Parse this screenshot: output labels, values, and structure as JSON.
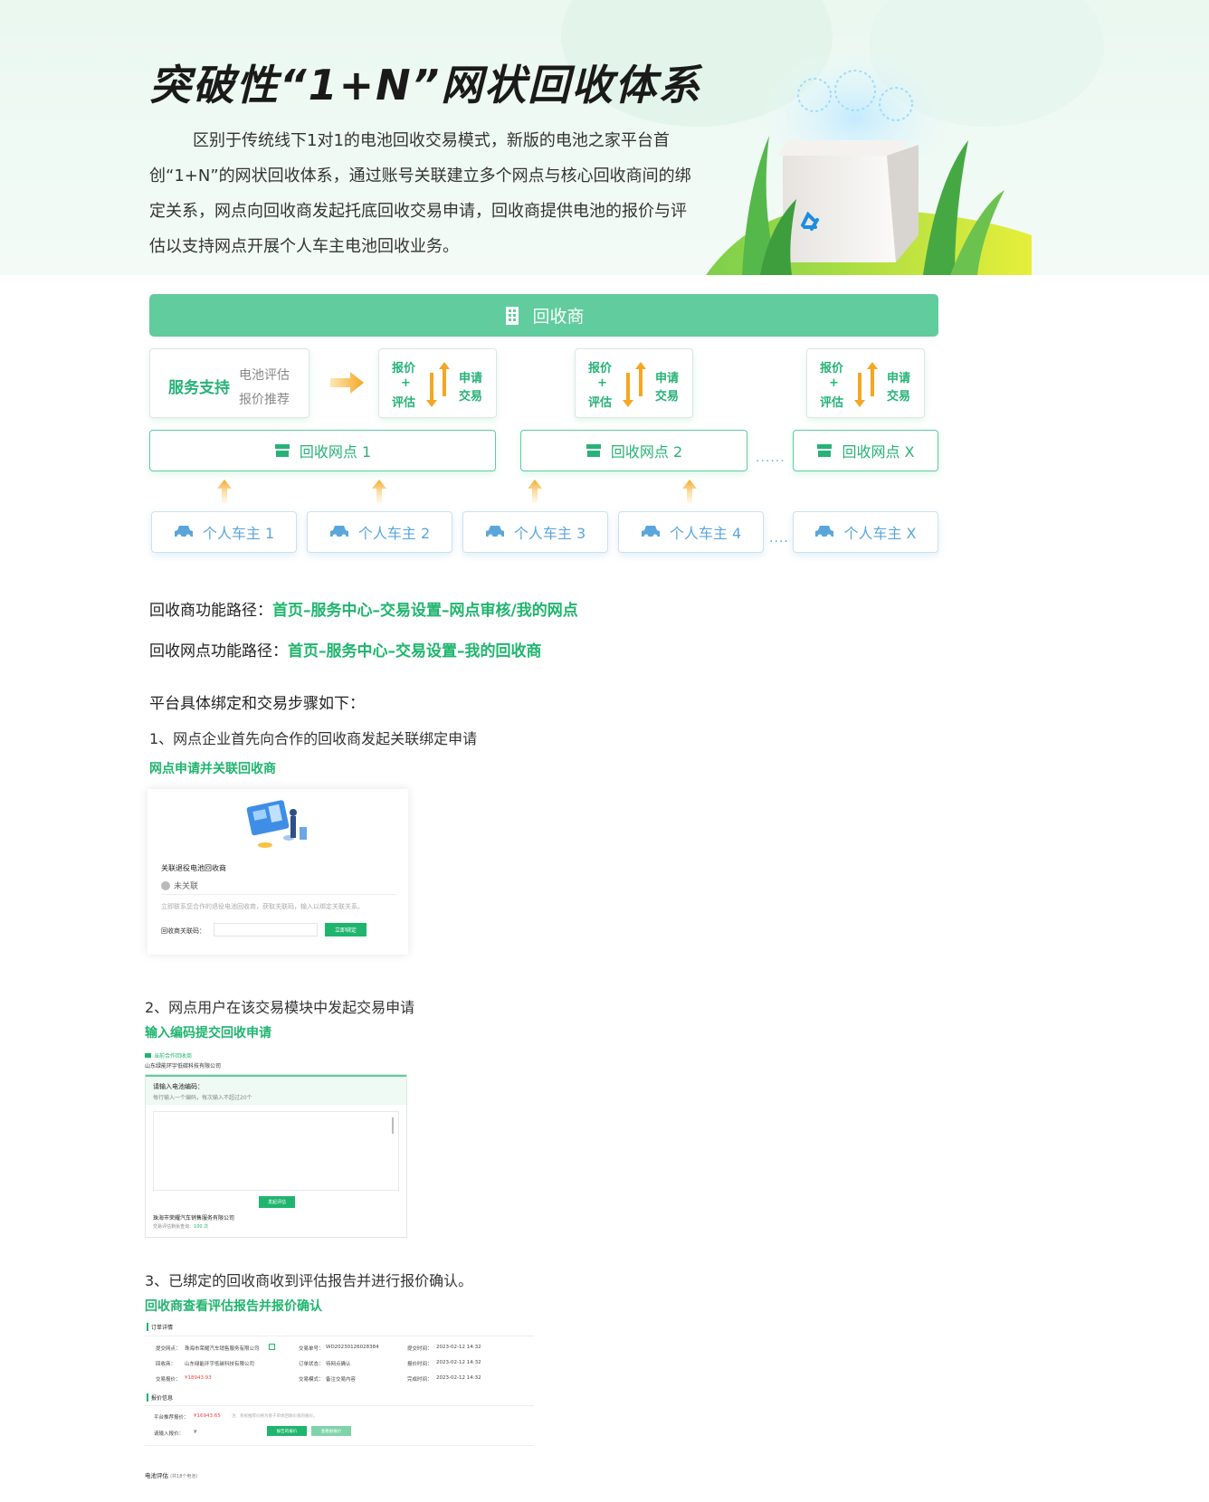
{
  "hero": {
    "title": "突破性“1+N”网状回收体系",
    "paragraph": "区别于传统线下1对1的电池回收交易模式，新版的电池之家平台首创“1+N”的网状回收体系，通过账号关联建立多个网点与核心回收商间的绑定关系，网点向回收商发起托底回收交易申请，回收商提供电池的报价与评估以支持网点开展个人车主电池回收业务。"
  },
  "diagram": {
    "recycler": "回收商",
    "support": {
      "label": "服务支持",
      "item1": "电池评估",
      "item2": "报价推荐"
    },
    "quote": {
      "q1": "报价",
      "plus": "+",
      "q2": "评估",
      "a1": "申请",
      "a2": "交易"
    },
    "sites": [
      "回收网点 1",
      "回收网点 2",
      "回收网点 X"
    ],
    "site_dots": "......",
    "owners": [
      "个人车主 1",
      "个人车主 2",
      "个人车主 3",
      "个人车主 4",
      "个人车主 X"
    ],
    "owner_dots": "....",
    "colors": {
      "green": "#61cc9d",
      "blue": "#5aa6dc",
      "arrow": "#f5a623"
    }
  },
  "paths": {
    "recycler_label": "回收商功能路径：",
    "recycler_value": "首页–服务中心–交易设置–网点审核/我的网点",
    "site_label": "回收网点功能路径：",
    "site_value": "首页–服务中心–交易设置–我的回收商"
  },
  "steps_title": "平台具体绑定和交易步骤如下：",
  "step1": {
    "title": "1、网点企业首先向合作的回收商发起关联绑定申请",
    "sub": "网点申请并关联回收商",
    "shot": {
      "title": "关联退役电池回收商",
      "status": "未关联",
      "desc": "立即联系您合作的退役电池回收商，获取关联码，输入以绑定关联关系。",
      "field": "回收商关联码：",
      "button": "立即绑定"
    }
  },
  "step2": {
    "title": "2、网点用户在该交易模块中发起交易申请",
    "sub": "输入编码提交回收申请",
    "shot": {
      "head1": "当前合作回收商",
      "head2": "山东绿能环宇低碳科技有限公司",
      "band1": "请输入电池编码：",
      "band2": "每行输入一个编码，每次输入不超过20个",
      "button": "发起评估",
      "company": "珠海市荣耀汽车销售服务有限公司",
      "remain_label": "交易评估剩余查询：",
      "remain_value": "100 次"
    }
  },
  "step3": {
    "title": "3、已绑定的回收商收到评估报告并进行报价确认。",
    "sub": "回收商查看评估报告并报价确认",
    "shot": {
      "order_section": "订单详情",
      "rows": [
        [
          "提交网点：",
          "珠海市荣耀汽车销售服务有限公司",
          "交易单号：",
          "WD20230126028384",
          "提交时间：",
          "2023-02-12 14:32"
        ],
        [
          "回收商：",
          "山东绿能环宇低碳科技有限公司",
          "订单状态：",
          "待网点确认",
          "报价时间：",
          "2023-02-12 14:32"
        ],
        [
          "交易报价：",
          "¥18943.93",
          "交易模式：",
          "备注交易内容",
          "完成时间：",
          "2023-02-12 14:32"
        ]
      ],
      "quote_section": "报价信息",
      "platform_label": "平台推荐报价：",
      "platform_value": "¥16943.65",
      "platform_note": "注：系统推荐价格为基于单体回收价值的报价。",
      "input_label": "请输入报价：",
      "input_prefix": "¥",
      "btn1": "报告的报价",
      "btn2": "查看报报价",
      "footer": "电池评估",
      "footer_note": "(共18个电池)"
    }
  }
}
